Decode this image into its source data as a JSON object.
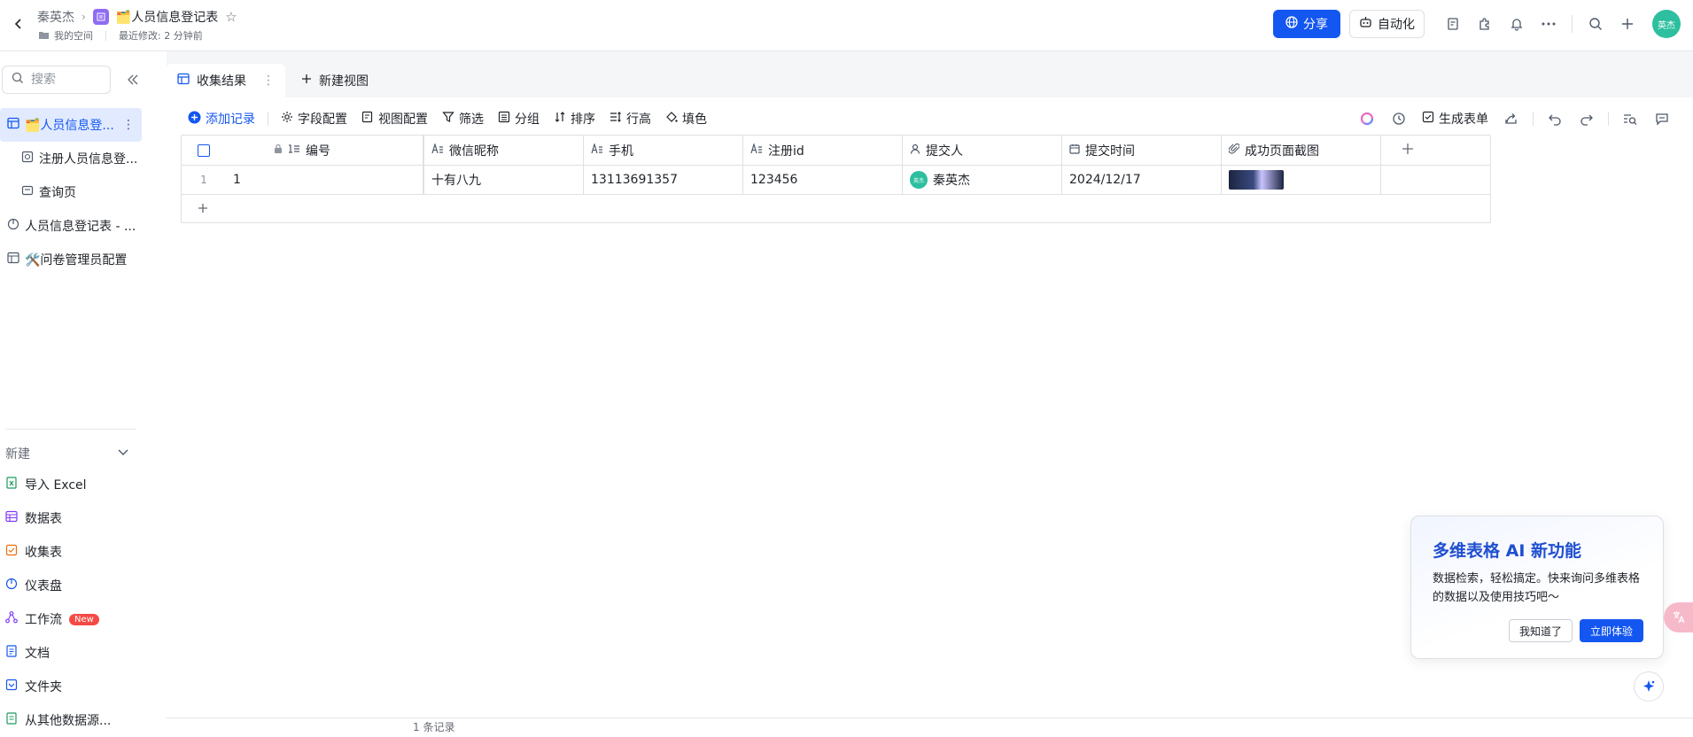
{
  "header": {
    "breadcrumb_owner": "秦英杰",
    "title": "🗂️人员信息登记表",
    "space": "我的空间",
    "modified": "最近修改: 2 分钟前",
    "share_label": "分享",
    "automation_label": "自动化",
    "avatar_text": "英杰"
  },
  "sidebar": {
    "search_placeholder": "搜索",
    "items": [
      {
        "label": "🗂️人员信息登..."
      },
      {
        "label": "注册人员信息登..."
      },
      {
        "label": "查询页"
      },
      {
        "label": "人员信息登记表 - ..."
      },
      {
        "label": "🛠️问卷管理员配置"
      }
    ],
    "new_label": "新建",
    "new_items": [
      {
        "label": "导入 Excel"
      },
      {
        "label": "数据表"
      },
      {
        "label": "收集表"
      },
      {
        "label": "仪表盘"
      },
      {
        "label": "工作流",
        "badge": "New"
      },
      {
        "label": "文档"
      },
      {
        "label": "文件夹"
      },
      {
        "label": "从其他数据源..."
      }
    ]
  },
  "tabs": {
    "active": "收集结果",
    "new_view": "新建视图"
  },
  "toolbar": {
    "add_record": "添加记录",
    "field_config": "字段配置",
    "view_config": "视图配置",
    "filter": "筛选",
    "group": "分组",
    "sort": "排序",
    "row_height": "行高",
    "fill": "填色",
    "generate_form": "生成表单"
  },
  "table": {
    "columns": [
      "编号",
      "微信昵称",
      "手机",
      "注册id",
      "提交人",
      "提交时间",
      "成功页面截图"
    ],
    "rows": [
      {
        "index": "1",
        "id": "1",
        "nickname": "十有八九",
        "phone": "13113691357",
        "reg_id": "123456",
        "submitter": "秦英杰",
        "submitter_avatar": "英杰",
        "time": "2024/12/17"
      }
    ]
  },
  "footer": {
    "record_count": "1 条记录"
  },
  "ai_popup": {
    "title": "多维表格 AI 新功能",
    "desc": "数据检索，轻松搞定。快来询问多维表格的数据以及使用技巧吧～",
    "dismiss": "我知道了",
    "try": "立即体验"
  },
  "colors": {
    "accent": "#1456f0",
    "avatar": "#2dbf9f",
    "active_bg": "#e1eaff"
  }
}
